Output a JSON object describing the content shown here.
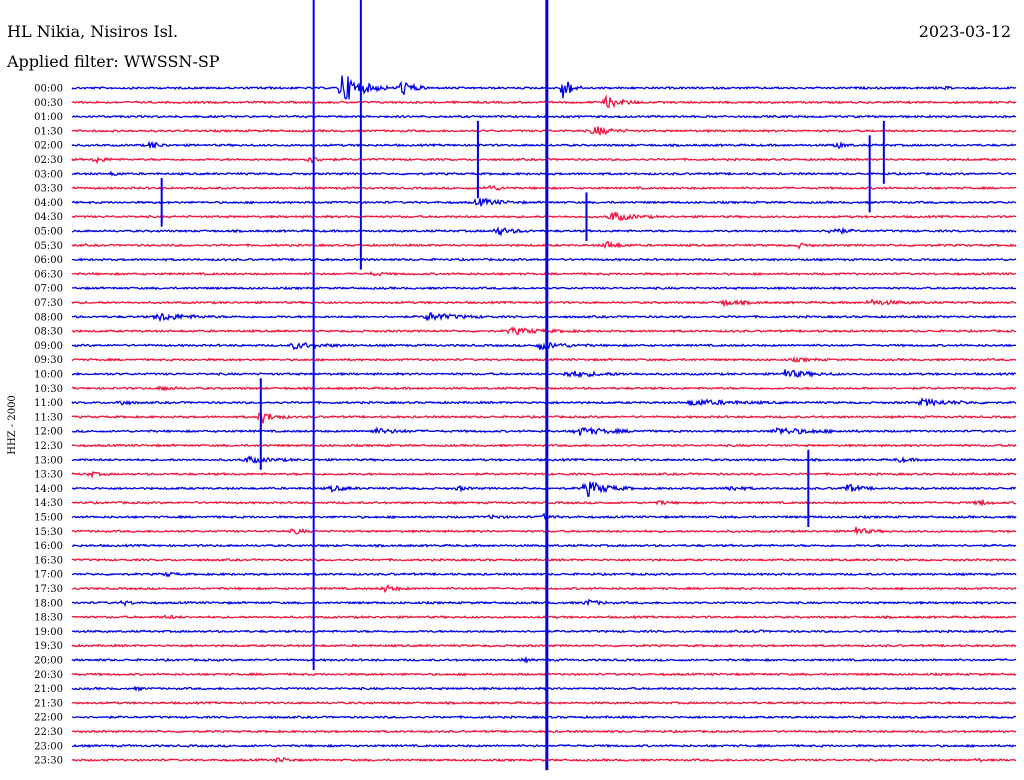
{
  "header": {
    "station": "HL Nikia, Nisiros Isl.",
    "filter": "Applied filter: WWSSN-SP",
    "date": "2023-03-12"
  },
  "colors": {
    "trace_a": "#0000e6",
    "trace_b": "#f0143c"
  },
  "chart_data": {
    "type": "line",
    "title": "HL Nikia, Nisiros Isl.",
    "ylabel": "HHZ - 2000",
    "row_interval_minutes": 30,
    "tick_labels": [
      "00:00",
      "00:30",
      "01:00",
      "01:30",
      "02:00",
      "02:30",
      "03:00",
      "03:30",
      "04:00",
      "04:30",
      "05:00",
      "05:30",
      "06:00",
      "06:30",
      "07:00",
      "07:30",
      "08:00",
      "08:30",
      "09:00",
      "09:30",
      "10:00",
      "10:30",
      "11:00",
      "11:30",
      "12:00",
      "12:30",
      "13:00",
      "13:30",
      "14:00",
      "14:30",
      "15:00",
      "15:30",
      "16:00",
      "16:30",
      "17:00",
      "17:30",
      "18:00",
      "18:30",
      "19:00",
      "19:30",
      "20:00",
      "20:30",
      "21:00",
      "21:30",
      "22:00",
      "22:30",
      "23:00",
      "23:30"
    ],
    "colors": [
      "blue",
      "red"
    ],
    "grid": false,
    "x_range_fraction": [
      0,
      1
    ],
    "events": [
      {
        "row": 0,
        "t": 0.203,
        "amp": 1.5,
        "dur": 0.01
      },
      {
        "row": 0,
        "t": 0.286,
        "amp": 16,
        "dur": 0.05
      },
      {
        "row": 0,
        "t": 0.348,
        "amp": 9,
        "dur": 0.03
      },
      {
        "row": 0,
        "t": 0.928,
        "amp": 1.6,
        "dur": 0.01
      },
      {
        "row": 0,
        "t": 0.52,
        "amp": 14,
        "dur": 0.02
      },
      {
        "row": 1,
        "t": 0.565,
        "amp": 6,
        "dur": 0.04
      },
      {
        "row": 3,
        "t": 0.553,
        "amp": 5,
        "dur": 0.04
      },
      {
        "row": 4,
        "t": 0.083,
        "amp": 4.5,
        "dur": 0.02
      },
      {
        "row": 4,
        "t": 0.81,
        "amp": 3,
        "dur": 0.02
      },
      {
        "row": 5,
        "t": 0.026,
        "amp": 3,
        "dur": 0.02
      },
      {
        "row": 5,
        "t": 0.25,
        "amp": 3,
        "dur": 0.03
      },
      {
        "row": 6,
        "t": 0.045,
        "amp": 2,
        "dur": 0.01
      },
      {
        "row": 7,
        "t": 0.44,
        "amp": 3,
        "dur": 0.03
      },
      {
        "row": 8,
        "t": 0.43,
        "amp": 4,
        "dur": 0.05
      },
      {
        "row": 9,
        "t": 0.57,
        "amp": 5,
        "dur": 0.05
      },
      {
        "row": 10,
        "t": 0.45,
        "amp": 4,
        "dur": 0.04
      },
      {
        "row": 10,
        "t": 0.805,
        "amp": 4,
        "dur": 0.03
      },
      {
        "row": 11,
        "t": 0.565,
        "amp": 4,
        "dur": 0.03
      },
      {
        "row": 11,
        "t": 0.77,
        "amp": 2,
        "dur": 0.02
      },
      {
        "row": 13,
        "t": 0.32,
        "amp": 2,
        "dur": 0.02
      },
      {
        "row": 15,
        "t": 0.69,
        "amp": 2.5,
        "dur": 0.05
      },
      {
        "row": 15,
        "t": 0.845,
        "amp": 2.5,
        "dur": 0.07
      },
      {
        "row": 16,
        "t": 0.09,
        "amp": 4,
        "dur": 0.07
      },
      {
        "row": 16,
        "t": 0.375,
        "amp": 4,
        "dur": 0.07
      },
      {
        "row": 17,
        "t": 0.465,
        "amp": 3,
        "dur": 0.08
      },
      {
        "row": 18,
        "t": 0.235,
        "amp": 3,
        "dur": 0.07
      },
      {
        "row": 18,
        "t": 0.495,
        "amp": 4,
        "dur": 0.06
      },
      {
        "row": 19,
        "t": 0.765,
        "amp": 1.5,
        "dur": 0.04
      },
      {
        "row": 20,
        "t": 0.525,
        "amp": 3,
        "dur": 0.08
      },
      {
        "row": 20,
        "t": 0.755,
        "amp": 4,
        "dur": 0.06
      },
      {
        "row": 21,
        "t": 0.095,
        "amp": 2,
        "dur": 0.03
      },
      {
        "row": 22,
        "t": 0.05,
        "amp": 3,
        "dur": 0.02
      },
      {
        "row": 22,
        "t": 0.655,
        "amp": 3,
        "dur": 0.1
      },
      {
        "row": 22,
        "t": 0.9,
        "amp": 3,
        "dur": 0.08
      },
      {
        "row": 23,
        "t": 0.2,
        "amp": 7,
        "dur": 0.03
      },
      {
        "row": 24,
        "t": 0.32,
        "amp": 2.5,
        "dur": 0.06
      },
      {
        "row": 24,
        "t": 0.535,
        "amp": 4,
        "dur": 0.08
      },
      {
        "row": 24,
        "t": 0.745,
        "amp": 3.5,
        "dur": 0.09
      },
      {
        "row": 26,
        "t": 0.185,
        "amp": 3,
        "dur": 0.06
      },
      {
        "row": 26,
        "t": 0.875,
        "amp": 2,
        "dur": 0.03
      },
      {
        "row": 27,
        "t": 0.02,
        "amp": 2,
        "dur": 0.02
      },
      {
        "row": 28,
        "t": 0.275,
        "amp": 3,
        "dur": 0.03
      },
      {
        "row": 28,
        "t": 0.41,
        "amp": 2,
        "dur": 0.02
      },
      {
        "row": 28,
        "t": 0.545,
        "amp": 8,
        "dur": 0.05
      },
      {
        "row": 28,
        "t": 0.695,
        "amp": 3,
        "dur": 0.03
      },
      {
        "row": 28,
        "t": 0.82,
        "amp": 5,
        "dur": 0.03
      },
      {
        "row": 29,
        "t": 0.622,
        "amp": 2,
        "dur": 0.02
      },
      {
        "row": 29,
        "t": 0.96,
        "amp": 3,
        "dur": 0.02
      },
      {
        "row": 30,
        "t": 0.445,
        "amp": 2,
        "dur": 0.02
      },
      {
        "row": 30,
        "t": 0.5,
        "amp": 3,
        "dur": 0.02
      },
      {
        "row": 31,
        "t": 0.235,
        "amp": 3,
        "dur": 0.02
      },
      {
        "row": 31,
        "t": 0.83,
        "amp": 4,
        "dur": 0.03
      },
      {
        "row": 34,
        "t": 0.1,
        "amp": 2,
        "dur": 0.02
      },
      {
        "row": 35,
        "t": 0.33,
        "amp": 3.5,
        "dur": 0.03
      },
      {
        "row": 36,
        "t": 0.055,
        "amp": 2,
        "dur": 0.02
      },
      {
        "row": 36,
        "t": 0.545,
        "amp": 3,
        "dur": 0.03
      },
      {
        "row": 37,
        "t": 0.1,
        "amp": 2,
        "dur": 0.02
      },
      {
        "row": 38,
        "t": 0.725,
        "amp": 1.5,
        "dur": 0.01
      },
      {
        "row": 40,
        "t": 0.48,
        "amp": 1.5,
        "dur": 0.01
      },
      {
        "row": 42,
        "t": 0.07,
        "amp": 1.5,
        "dur": 0.01
      },
      {
        "row": 47,
        "t": 0.22,
        "amp": 3,
        "dur": 0.02
      },
      {
        "row": 47,
        "t": 0.96,
        "amp": 1.5,
        "dur": 0.01
      }
    ],
    "spikes": [
      {
        "t": 0.256,
        "from_row": 0,
        "to_row": 40
      },
      {
        "t": 0.306,
        "from_row": 0,
        "to_row": 12
      },
      {
        "t": 0.503,
        "from_row": 0,
        "to_row": 47
      },
      {
        "t": 0.43,
        "from_row": 3,
        "to_row": 7
      },
      {
        "t": 0.545,
        "from_row": 8,
        "to_row": 10
      },
      {
        "t": 0.845,
        "from_row": 4,
        "to_row": 8
      },
      {
        "t": 0.86,
        "from_row": 3,
        "to_row": 6
      },
      {
        "t": 0.095,
        "from_row": 7,
        "to_row": 9
      },
      {
        "t": 0.2,
        "from_row": 21,
        "to_row": 26
      },
      {
        "t": 0.78,
        "from_row": 26,
        "to_row": 30
      }
    ]
  }
}
